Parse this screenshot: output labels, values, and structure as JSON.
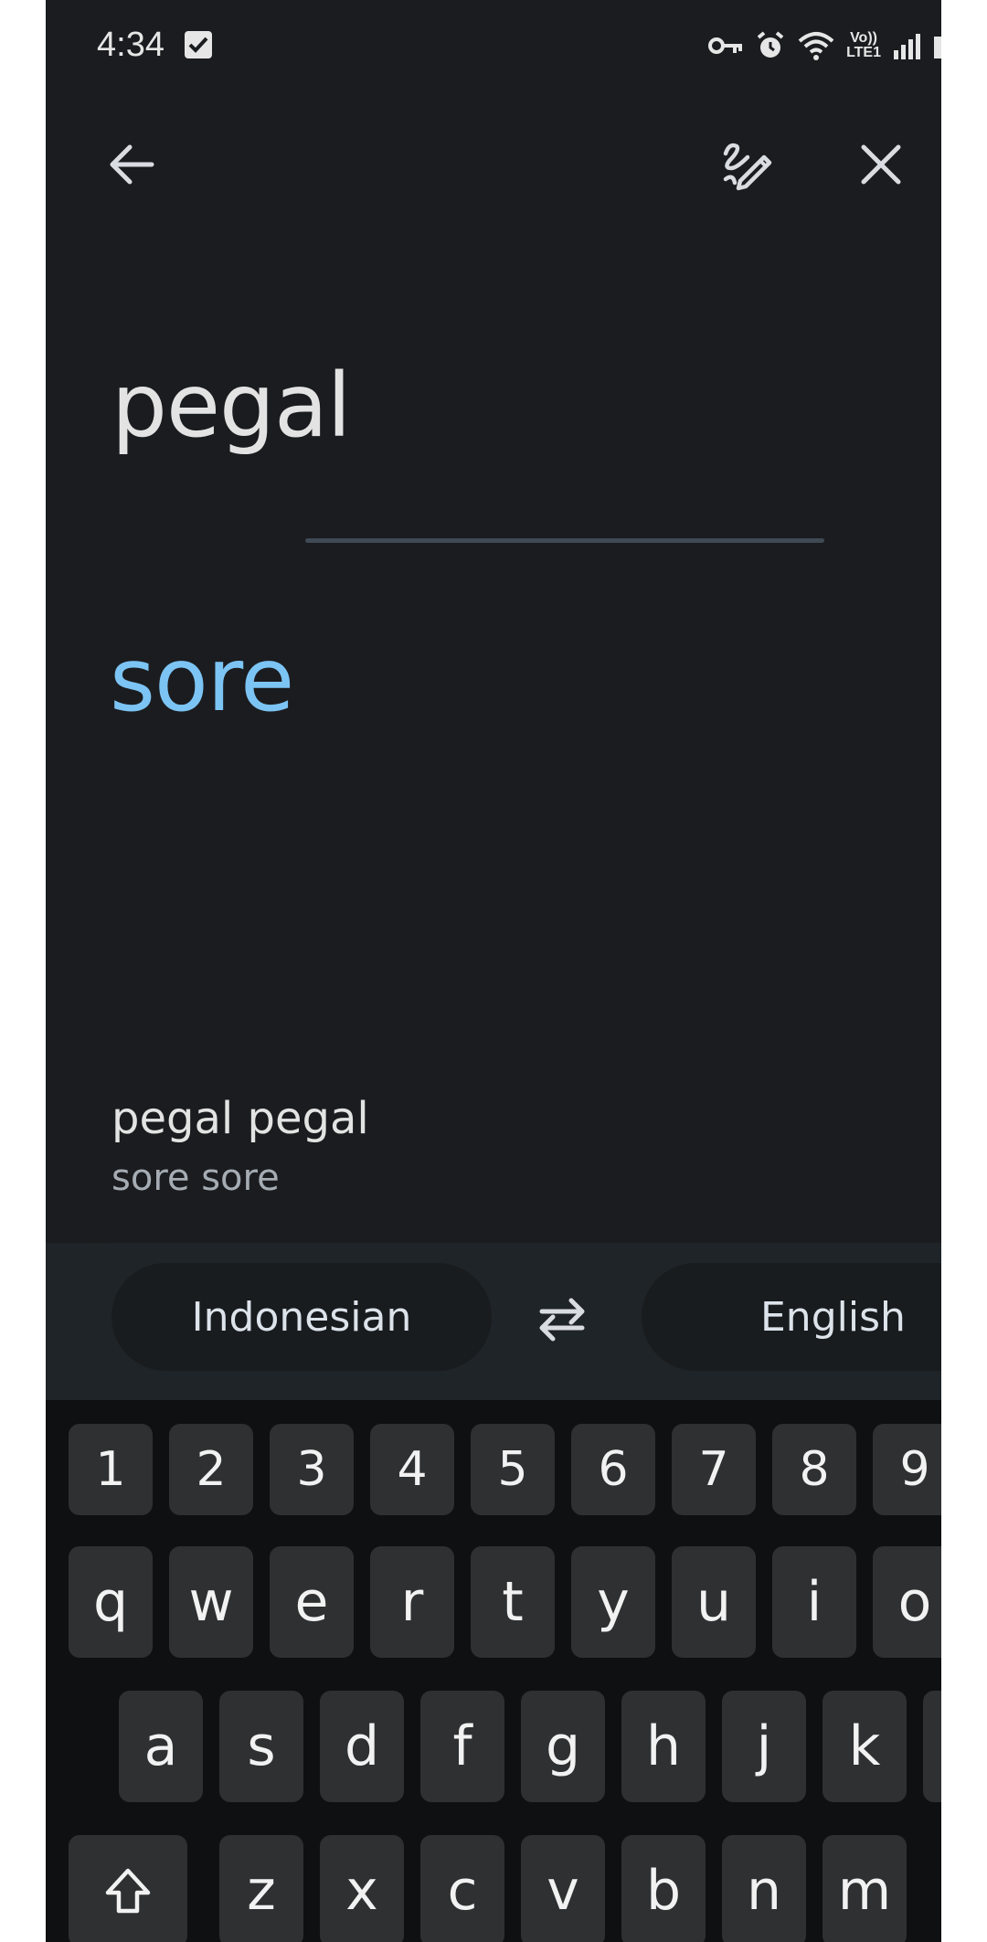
{
  "status_bar": {
    "time": "4:34",
    "network_label": "Vo))\nLTE1"
  },
  "toolbar": {
    "back_icon": "arrow-back",
    "handwriting_icon": "pen-handwriting",
    "close_icon": "close-x"
  },
  "translation": {
    "source_text": "pegal",
    "translated_text": "sore",
    "suggestion": {
      "source": "pegal pegal",
      "target": "sore sore"
    }
  },
  "languages": {
    "source": "Indonesian",
    "target": "English",
    "swap_icon": "swap-arrows"
  },
  "keyboard": {
    "number_row": [
      "1",
      "2",
      "3",
      "4",
      "5",
      "6",
      "7",
      "8",
      "9"
    ],
    "row1": [
      "q",
      "w",
      "e",
      "r",
      "t",
      "y",
      "u",
      "i",
      "o"
    ],
    "row2": [
      "a",
      "s",
      "d",
      "f",
      "g",
      "h",
      "j",
      "k"
    ],
    "row3": [
      "z",
      "x",
      "c",
      "v",
      "b",
      "n",
      "m"
    ],
    "shift_icon": "shift-arrow"
  },
  "colors": {
    "background": "#1a1c1f",
    "accent_translation": "#7cc4f4",
    "chip_background": "#191c1f",
    "key_background": "#2f3031"
  }
}
